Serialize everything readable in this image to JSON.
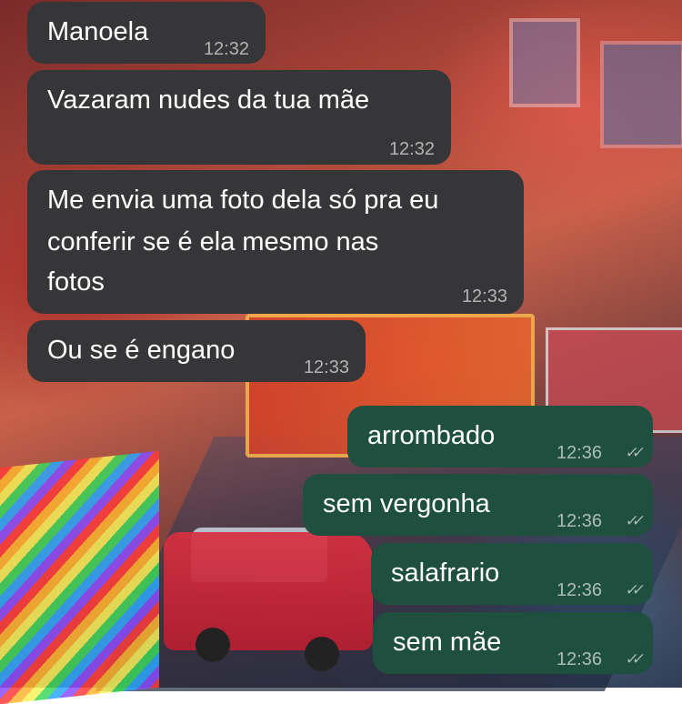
{
  "messages": [
    {
      "direction": "incoming",
      "sender": "Manoela",
      "time": "12:32"
    },
    {
      "direction": "incoming",
      "text": "Vazaram nudes da tua mãe",
      "time": "12:32"
    },
    {
      "direction": "incoming",
      "lines": [
        "Me envia uma foto dela só pra eu",
        "conferir se é ela mesmo nas",
        "fotos"
      ],
      "time": "12:33"
    },
    {
      "direction": "incoming",
      "text": "Ou se é engano",
      "time": "12:33"
    },
    {
      "direction": "outgoing",
      "text": "arrombado",
      "time": "12:36",
      "status": "read-check-icon"
    },
    {
      "direction": "outgoing",
      "text": "sem vergonha",
      "time": "12:36",
      "status": "read-check-icon"
    },
    {
      "direction": "outgoing",
      "text": "salafrario",
      "time": "12:36",
      "status": "read-check-icon"
    },
    {
      "direction": "outgoing",
      "text": "sem mãe",
      "time": "12:36",
      "status": "read-check-icon"
    }
  ],
  "colors": {
    "incoming_bubble": "#363638",
    "outgoing_bubble": "#1f4f3e",
    "text": "#ffffff",
    "timestamp": "#a5a5a7"
  }
}
